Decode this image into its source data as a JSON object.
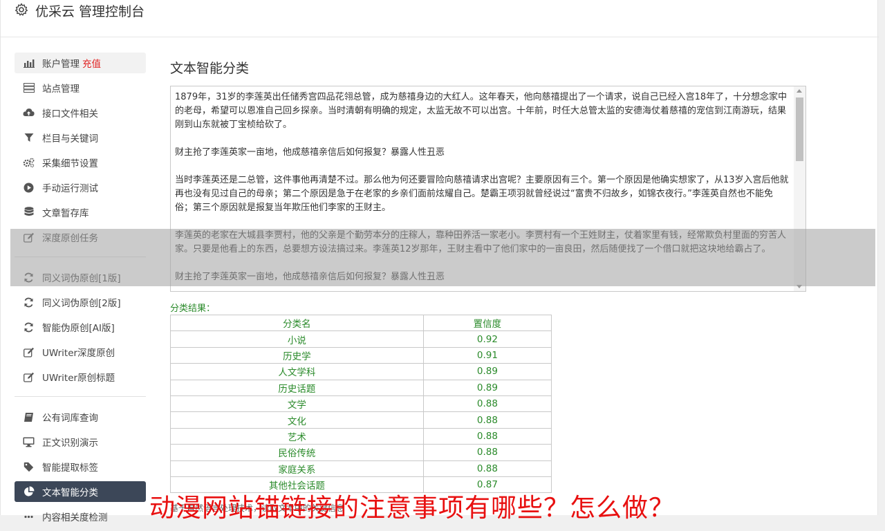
{
  "header": {
    "title": "优采云 管理控制台"
  },
  "sidebar": {
    "groups": [
      [
        {
          "icon": "bar-chart-icon",
          "label": "账户管理",
          "extra": "充值"
        },
        {
          "icon": "server-icon",
          "label": "站点管理"
        },
        {
          "icon": "cloud-upload-icon",
          "label": "接口文件相关"
        },
        {
          "icon": "filter-icon",
          "label": "栏目与关键词"
        },
        {
          "icon": "cogs-icon",
          "label": "采集细节设置"
        },
        {
          "icon": "play-circle-icon",
          "label": "手动运行测试"
        },
        {
          "icon": "database-icon",
          "label": "文章暂存库"
        },
        {
          "icon": "edit-icon",
          "label": "深度原创任务"
        }
      ],
      [
        {
          "icon": "refresh-icon",
          "label": "同义词伪原创[1版]"
        },
        {
          "icon": "refresh-icon",
          "label": "同义词伪原创[2版]"
        },
        {
          "icon": "refresh-icon",
          "label": "智能伪原创[AI版]"
        },
        {
          "icon": "edit-icon",
          "label": "UWriter深度原创"
        },
        {
          "icon": "edit-icon",
          "label": "UWriter原创标题"
        }
      ],
      [
        {
          "icon": "book-icon",
          "label": "公有词库查询"
        },
        {
          "icon": "monitor-icon",
          "label": "正文识别演示"
        },
        {
          "icon": "tag-icon",
          "label": "智能提取标签"
        },
        {
          "icon": "pie-chart-icon",
          "label": "文本智能分类"
        },
        {
          "icon": "ellipsis-icon",
          "label": "内容相关度检测"
        }
      ]
    ]
  },
  "main": {
    "title": "文本智能分类",
    "text_paragraphs": [
      "1879年，31岁的李莲英出任储秀宫四品花翎总管，成为慈禧身边的大红人。这年春天，他向慈禧提出了一个请求，说自己已经入宫18年了，十分想念家中的老母，希望可以恩准自己回乡探亲。当时清朝有明确的规定，太监无故不可以出宫。十年前，时任大总管太监的安德海仗着慈禧的宠信到江南游玩，结果刚到山东就被丁宝桢给砍了。",
      "财主抢了李莲英家一亩地，他成慈禧亲信后如何报复？暴露人性丑恶",
      "当时李莲英还是二总管，这件事他再清楚不过。那么他为何还要冒险向慈禧请求出宫呢？主要原因有三个。第一个原因是他确实想家了，从13岁入宫后他就再也没有见过自己的母亲；第二个原因是急于在老家的乡亲们面前炫耀自己。楚霸王项羽就曾经说过“富贵不归故乡，如锦衣夜行。”李莲英自然也不能免俗；第三个原因就是报复当年欺压他们李家的王财主。",
      "李莲英的老家在大城县李贾村，他的父亲是个勤劳本分的庄稼人，靠种田养活一家老小。李贾村有一个王姓财主，仗着家里有钱，经常欺负村里面的穷苦人家。只要是他看上的东西，总要想方设法搞过来。李莲英12岁那年，王财主看中了他们家中的一亩良田，然后随便找了一个借口就把这块地给霸占了。",
      "财主抢了李莲英家一亩地，他成慈禧亲信后如何报复？暴露人性丑恶"
    ],
    "result_label": "分类结果：",
    "table": {
      "headers": [
        "分类名",
        "置信度"
      ],
      "rows": [
        [
          "小说",
          "0.92"
        ],
        [
          "历史学",
          "0.91"
        ],
        [
          "人文学科",
          "0.89"
        ],
        [
          "历史话题",
          "0.89"
        ],
        [
          "文学",
          "0.88"
        ],
        [
          "文化",
          "0.88"
        ],
        [
          "艺术",
          "0.88"
        ],
        [
          "民俗传统",
          "0.88"
        ],
        [
          "家庭关系",
          "0.88"
        ],
        [
          "其他社会话题",
          "0.87"
        ]
      ]
    },
    "footer_text": "基于自然语言处理技术，读取文本中的关键信息"
  },
  "watermark": "动漫网站锚链接的注意事项有哪些？怎么做？",
  "colors": {
    "accent_green": "#2a8a2a",
    "active_nav": "#3c4758",
    "red": "#e02020"
  }
}
